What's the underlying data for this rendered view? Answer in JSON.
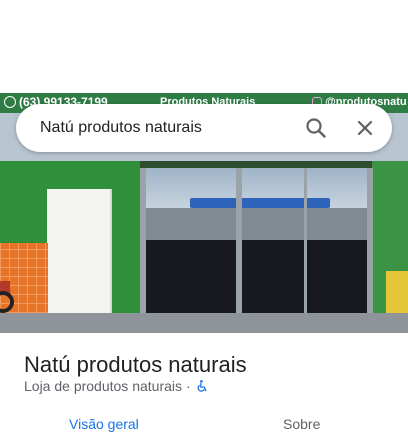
{
  "photo": {
    "sign_phone": "(63) 99133-7199",
    "sign_name": "Produtos Naturais",
    "sign_social": "@produtosnatu"
  },
  "search": {
    "query": "Natú produtos naturais",
    "search_icon": "search-icon",
    "close_icon": "close-icon"
  },
  "place": {
    "name": "Natú produtos naturais",
    "category": "Loja de produtos naturais",
    "separator": "·",
    "accessibility_icon": "wheelchair-icon",
    "accessibility_color": "#1a73e8"
  },
  "tabs": [
    {
      "label": "Visão geral",
      "active": true
    },
    {
      "label": "Sobre",
      "active": false
    }
  ],
  "colors": {
    "accent": "#1a73e8",
    "text_primary": "#202124",
    "text_secondary": "#5f6368"
  }
}
